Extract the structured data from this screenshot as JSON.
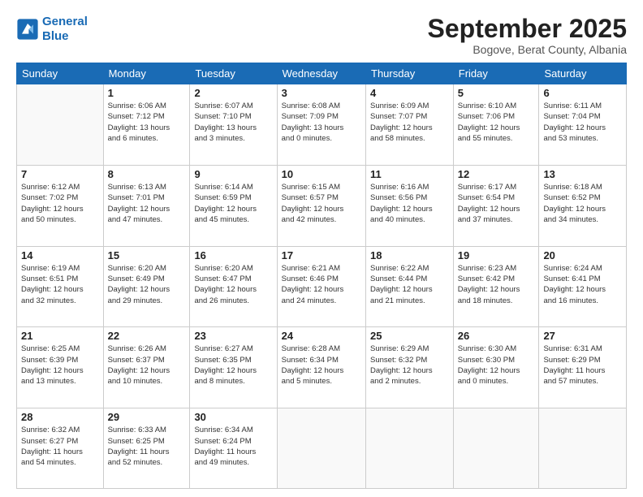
{
  "logo": {
    "text_general": "General",
    "text_blue": "Blue"
  },
  "header": {
    "month": "September 2025",
    "location": "Bogove, Berat County, Albania"
  },
  "weekdays": [
    "Sunday",
    "Monday",
    "Tuesday",
    "Wednesday",
    "Thursday",
    "Friday",
    "Saturday"
  ],
  "weeks": [
    [
      {
        "day": "",
        "info": ""
      },
      {
        "day": "1",
        "info": "Sunrise: 6:06 AM\nSunset: 7:12 PM\nDaylight: 13 hours\nand 6 minutes."
      },
      {
        "day": "2",
        "info": "Sunrise: 6:07 AM\nSunset: 7:10 PM\nDaylight: 13 hours\nand 3 minutes."
      },
      {
        "day": "3",
        "info": "Sunrise: 6:08 AM\nSunset: 7:09 PM\nDaylight: 13 hours\nand 0 minutes."
      },
      {
        "day": "4",
        "info": "Sunrise: 6:09 AM\nSunset: 7:07 PM\nDaylight: 12 hours\nand 58 minutes."
      },
      {
        "day": "5",
        "info": "Sunrise: 6:10 AM\nSunset: 7:06 PM\nDaylight: 12 hours\nand 55 minutes."
      },
      {
        "day": "6",
        "info": "Sunrise: 6:11 AM\nSunset: 7:04 PM\nDaylight: 12 hours\nand 53 minutes."
      }
    ],
    [
      {
        "day": "7",
        "info": "Sunrise: 6:12 AM\nSunset: 7:02 PM\nDaylight: 12 hours\nand 50 minutes."
      },
      {
        "day": "8",
        "info": "Sunrise: 6:13 AM\nSunset: 7:01 PM\nDaylight: 12 hours\nand 47 minutes."
      },
      {
        "day": "9",
        "info": "Sunrise: 6:14 AM\nSunset: 6:59 PM\nDaylight: 12 hours\nand 45 minutes."
      },
      {
        "day": "10",
        "info": "Sunrise: 6:15 AM\nSunset: 6:57 PM\nDaylight: 12 hours\nand 42 minutes."
      },
      {
        "day": "11",
        "info": "Sunrise: 6:16 AM\nSunset: 6:56 PM\nDaylight: 12 hours\nand 40 minutes."
      },
      {
        "day": "12",
        "info": "Sunrise: 6:17 AM\nSunset: 6:54 PM\nDaylight: 12 hours\nand 37 minutes."
      },
      {
        "day": "13",
        "info": "Sunrise: 6:18 AM\nSunset: 6:52 PM\nDaylight: 12 hours\nand 34 minutes."
      }
    ],
    [
      {
        "day": "14",
        "info": "Sunrise: 6:19 AM\nSunset: 6:51 PM\nDaylight: 12 hours\nand 32 minutes."
      },
      {
        "day": "15",
        "info": "Sunrise: 6:20 AM\nSunset: 6:49 PM\nDaylight: 12 hours\nand 29 minutes."
      },
      {
        "day": "16",
        "info": "Sunrise: 6:20 AM\nSunset: 6:47 PM\nDaylight: 12 hours\nand 26 minutes."
      },
      {
        "day": "17",
        "info": "Sunrise: 6:21 AM\nSunset: 6:46 PM\nDaylight: 12 hours\nand 24 minutes."
      },
      {
        "day": "18",
        "info": "Sunrise: 6:22 AM\nSunset: 6:44 PM\nDaylight: 12 hours\nand 21 minutes."
      },
      {
        "day": "19",
        "info": "Sunrise: 6:23 AM\nSunset: 6:42 PM\nDaylight: 12 hours\nand 18 minutes."
      },
      {
        "day": "20",
        "info": "Sunrise: 6:24 AM\nSunset: 6:41 PM\nDaylight: 12 hours\nand 16 minutes."
      }
    ],
    [
      {
        "day": "21",
        "info": "Sunrise: 6:25 AM\nSunset: 6:39 PM\nDaylight: 12 hours\nand 13 minutes."
      },
      {
        "day": "22",
        "info": "Sunrise: 6:26 AM\nSunset: 6:37 PM\nDaylight: 12 hours\nand 10 minutes."
      },
      {
        "day": "23",
        "info": "Sunrise: 6:27 AM\nSunset: 6:35 PM\nDaylight: 12 hours\nand 8 minutes."
      },
      {
        "day": "24",
        "info": "Sunrise: 6:28 AM\nSunset: 6:34 PM\nDaylight: 12 hours\nand 5 minutes."
      },
      {
        "day": "25",
        "info": "Sunrise: 6:29 AM\nSunset: 6:32 PM\nDaylight: 12 hours\nand 2 minutes."
      },
      {
        "day": "26",
        "info": "Sunrise: 6:30 AM\nSunset: 6:30 PM\nDaylight: 12 hours\nand 0 minutes."
      },
      {
        "day": "27",
        "info": "Sunrise: 6:31 AM\nSunset: 6:29 PM\nDaylight: 11 hours\nand 57 minutes."
      }
    ],
    [
      {
        "day": "28",
        "info": "Sunrise: 6:32 AM\nSunset: 6:27 PM\nDaylight: 11 hours\nand 54 minutes."
      },
      {
        "day": "29",
        "info": "Sunrise: 6:33 AM\nSunset: 6:25 PM\nDaylight: 11 hours\nand 52 minutes."
      },
      {
        "day": "30",
        "info": "Sunrise: 6:34 AM\nSunset: 6:24 PM\nDaylight: 11 hours\nand 49 minutes."
      },
      {
        "day": "",
        "info": ""
      },
      {
        "day": "",
        "info": ""
      },
      {
        "day": "",
        "info": ""
      },
      {
        "day": "",
        "info": ""
      }
    ]
  ]
}
